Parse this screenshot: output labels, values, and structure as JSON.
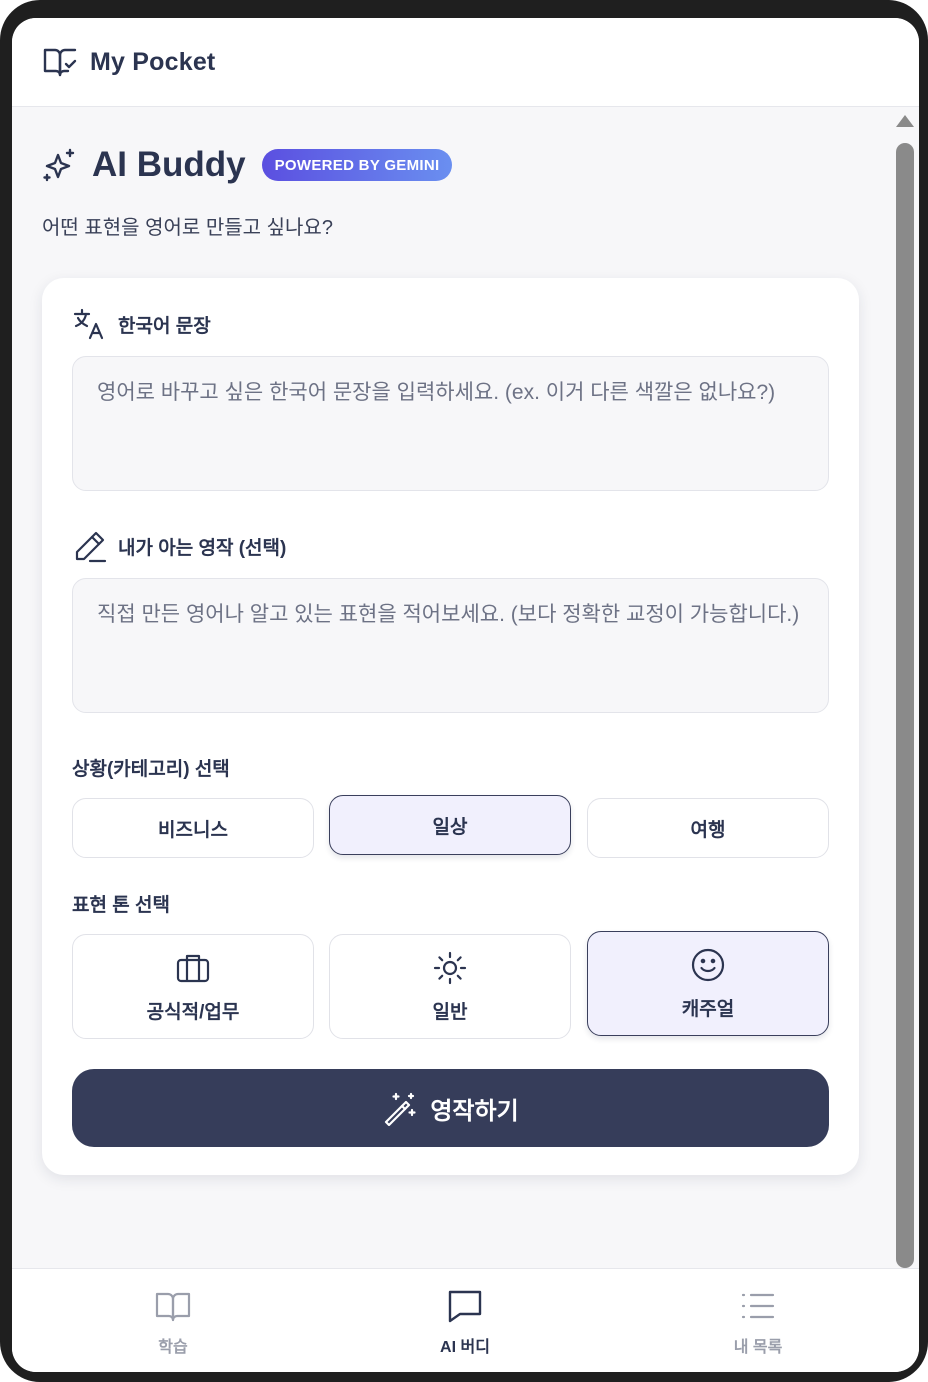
{
  "header": {
    "app_title": "My Pocket",
    "logo_icon": "book-check-icon"
  },
  "main": {
    "title": "AI Buddy",
    "badge": "POWERED BY GEMINI",
    "subtitle": "어떤 표현을 영어로 만들고 싶나요?"
  },
  "form": {
    "korean_label": "한국어 문장",
    "korean_icon": "translate-icon",
    "korean_placeholder": "영어로 바꾸고 싶은 한국어 문장을 입력하세요. (ex. 이거 다른 색깔은 없나요?)",
    "korean_value": "",
    "english_label": "내가 아는 영작 (선택)",
    "english_icon": "pencil-icon",
    "english_placeholder": "직접 만든 영어나 알고 있는 표현을 적어보세요. (보다 정확한 교정이 가능합니다.)",
    "english_value": "",
    "category_label": "상황(카테고리) 선택",
    "categories": [
      {
        "label": "비즈니스",
        "selected": false
      },
      {
        "label": "일상",
        "selected": true
      },
      {
        "label": "여행",
        "selected": false
      }
    ],
    "tone_label": "표현 톤 선택",
    "tones": [
      {
        "label": "공식적/업무",
        "icon": "briefcase-icon",
        "selected": false
      },
      {
        "label": "일반",
        "icon": "sun-icon",
        "selected": false
      },
      {
        "label": "캐주얼",
        "icon": "smile-icon",
        "selected": true
      }
    ],
    "submit_label": "영작하기",
    "submit_icon": "magic-wand-icon"
  },
  "nav": {
    "items": [
      {
        "label": "학습",
        "icon": "book-open-icon",
        "active": false
      },
      {
        "label": "AI 버디",
        "icon": "chat-bubble-icon",
        "active": true
      },
      {
        "label": "내 목록",
        "icon": "list-icon",
        "active": false
      }
    ]
  },
  "colors": {
    "primary": "#363d5a",
    "accent_start": "#5b4fe0",
    "accent_end": "#6a8ff0",
    "selected_bg": "#f1f0fd",
    "inactive_nav": "#9a9eab"
  }
}
